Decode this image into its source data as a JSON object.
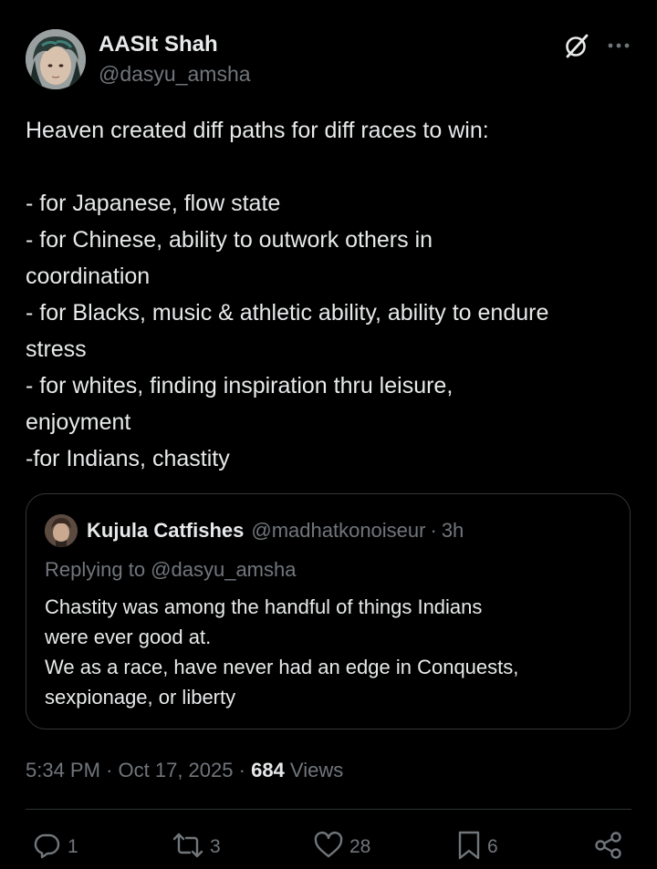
{
  "author": {
    "display_name": "AASIt Shah",
    "handle": "@dasyu_amsha"
  },
  "tweet": {
    "lines": [
      "Heaven created diff paths for diff races to win:",
      "",
      "- for Japanese, flow state",
      "- for Chinese, ability to outwork others in",
      "coordination",
      "- for Blacks, music & athletic ability, ability to endure",
      "stress",
      "- for whites, finding inspiration thru leisure,",
      "enjoyment",
      "-for Indians, chastity"
    ]
  },
  "quote": {
    "display_name": "Kujula Catfishes",
    "handle": "@madhatkonoiseur",
    "separator": "·",
    "time": "3h",
    "replying_to": "Replying to @dasyu_amsha",
    "lines": [
      "Chastity was among the handful of things Indians",
      "were ever good at.",
      "We as a race, have never had an edge in Conquests,",
      "sexpionage, or liberty"
    ]
  },
  "meta": {
    "time": "5:34 PM",
    "separator": "·",
    "date": "Oct 17, 2025",
    "views_count": "684",
    "views_label": "Views"
  },
  "actions": {
    "replies": "1",
    "reposts": "3",
    "likes": "28",
    "bookmarks": "6"
  },
  "icons": {
    "header": [
      "grok-icon",
      "more-icon"
    ],
    "action_bar": [
      "reply-icon",
      "repost-icon",
      "like-icon",
      "bookmark-icon",
      "share-icon"
    ]
  },
  "colors": {
    "background": "#000000",
    "text_primary": "#e7e9ea",
    "text_secondary": "#71767b",
    "border": "#333639"
  }
}
